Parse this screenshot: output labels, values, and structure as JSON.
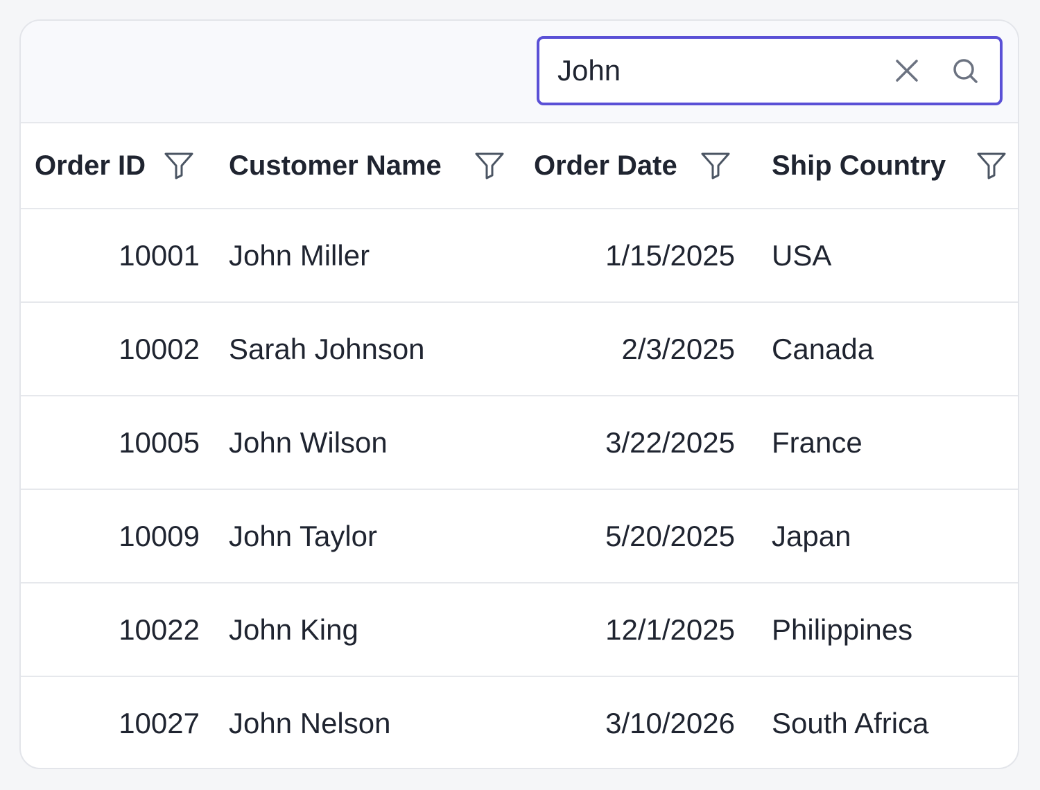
{
  "search": {
    "value": "John"
  },
  "columns": [
    {
      "label": "Order ID"
    },
    {
      "label": "Customer Name"
    },
    {
      "label": "Order Date"
    },
    {
      "label": "Ship Country"
    }
  ],
  "rows": [
    {
      "order_id": "10001",
      "customer_name": "John Miller",
      "order_date": "1/15/2025",
      "ship_country": "USA"
    },
    {
      "order_id": "10002",
      "customer_name": "Sarah Johnson",
      "order_date": "2/3/2025",
      "ship_country": "Canada"
    },
    {
      "order_id": "10005",
      "customer_name": "John Wilson",
      "order_date": "3/22/2025",
      "ship_country": "France"
    },
    {
      "order_id": "10009",
      "customer_name": "John Taylor",
      "order_date": "5/20/2025",
      "ship_country": "Japan"
    },
    {
      "order_id": "10022",
      "customer_name": "John King",
      "order_date": "12/1/2025",
      "ship_country": "Philippines"
    },
    {
      "order_id": "10027",
      "customer_name": "John Nelson",
      "order_date": "3/10/2026",
      "ship_country": "South Africa"
    }
  ],
  "colors": {
    "accent": "#5a50d6",
    "text": "#1f2430",
    "border": "#e6e8ec",
    "toolbar_bg": "#f8f9fc"
  }
}
